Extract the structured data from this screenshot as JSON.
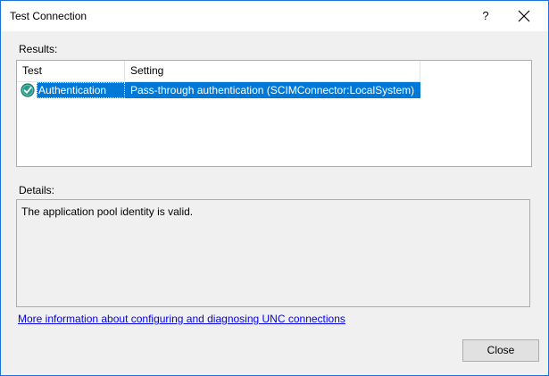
{
  "window": {
    "title": "Test Connection",
    "help_glyph": "?"
  },
  "results": {
    "label": "Results:",
    "columns": [
      "Test",
      "Setting"
    ],
    "rows": [
      {
        "status_icon": "success-check-icon",
        "test": "Authentication",
        "setting": "Pass-through authentication (SCIMConnector:LocalSystem)",
        "selected": true
      }
    ]
  },
  "details": {
    "label": "Details:",
    "text": "The application pool identity is valid."
  },
  "link": {
    "text": "More information about configuring and diagnosing UNC connections"
  },
  "buttons": {
    "close_label": "Close"
  },
  "colors": {
    "selection": "#0078d7",
    "link": "#0000ee",
    "window_border": "#1a73d9",
    "success_icon": "#2a9a8a"
  }
}
